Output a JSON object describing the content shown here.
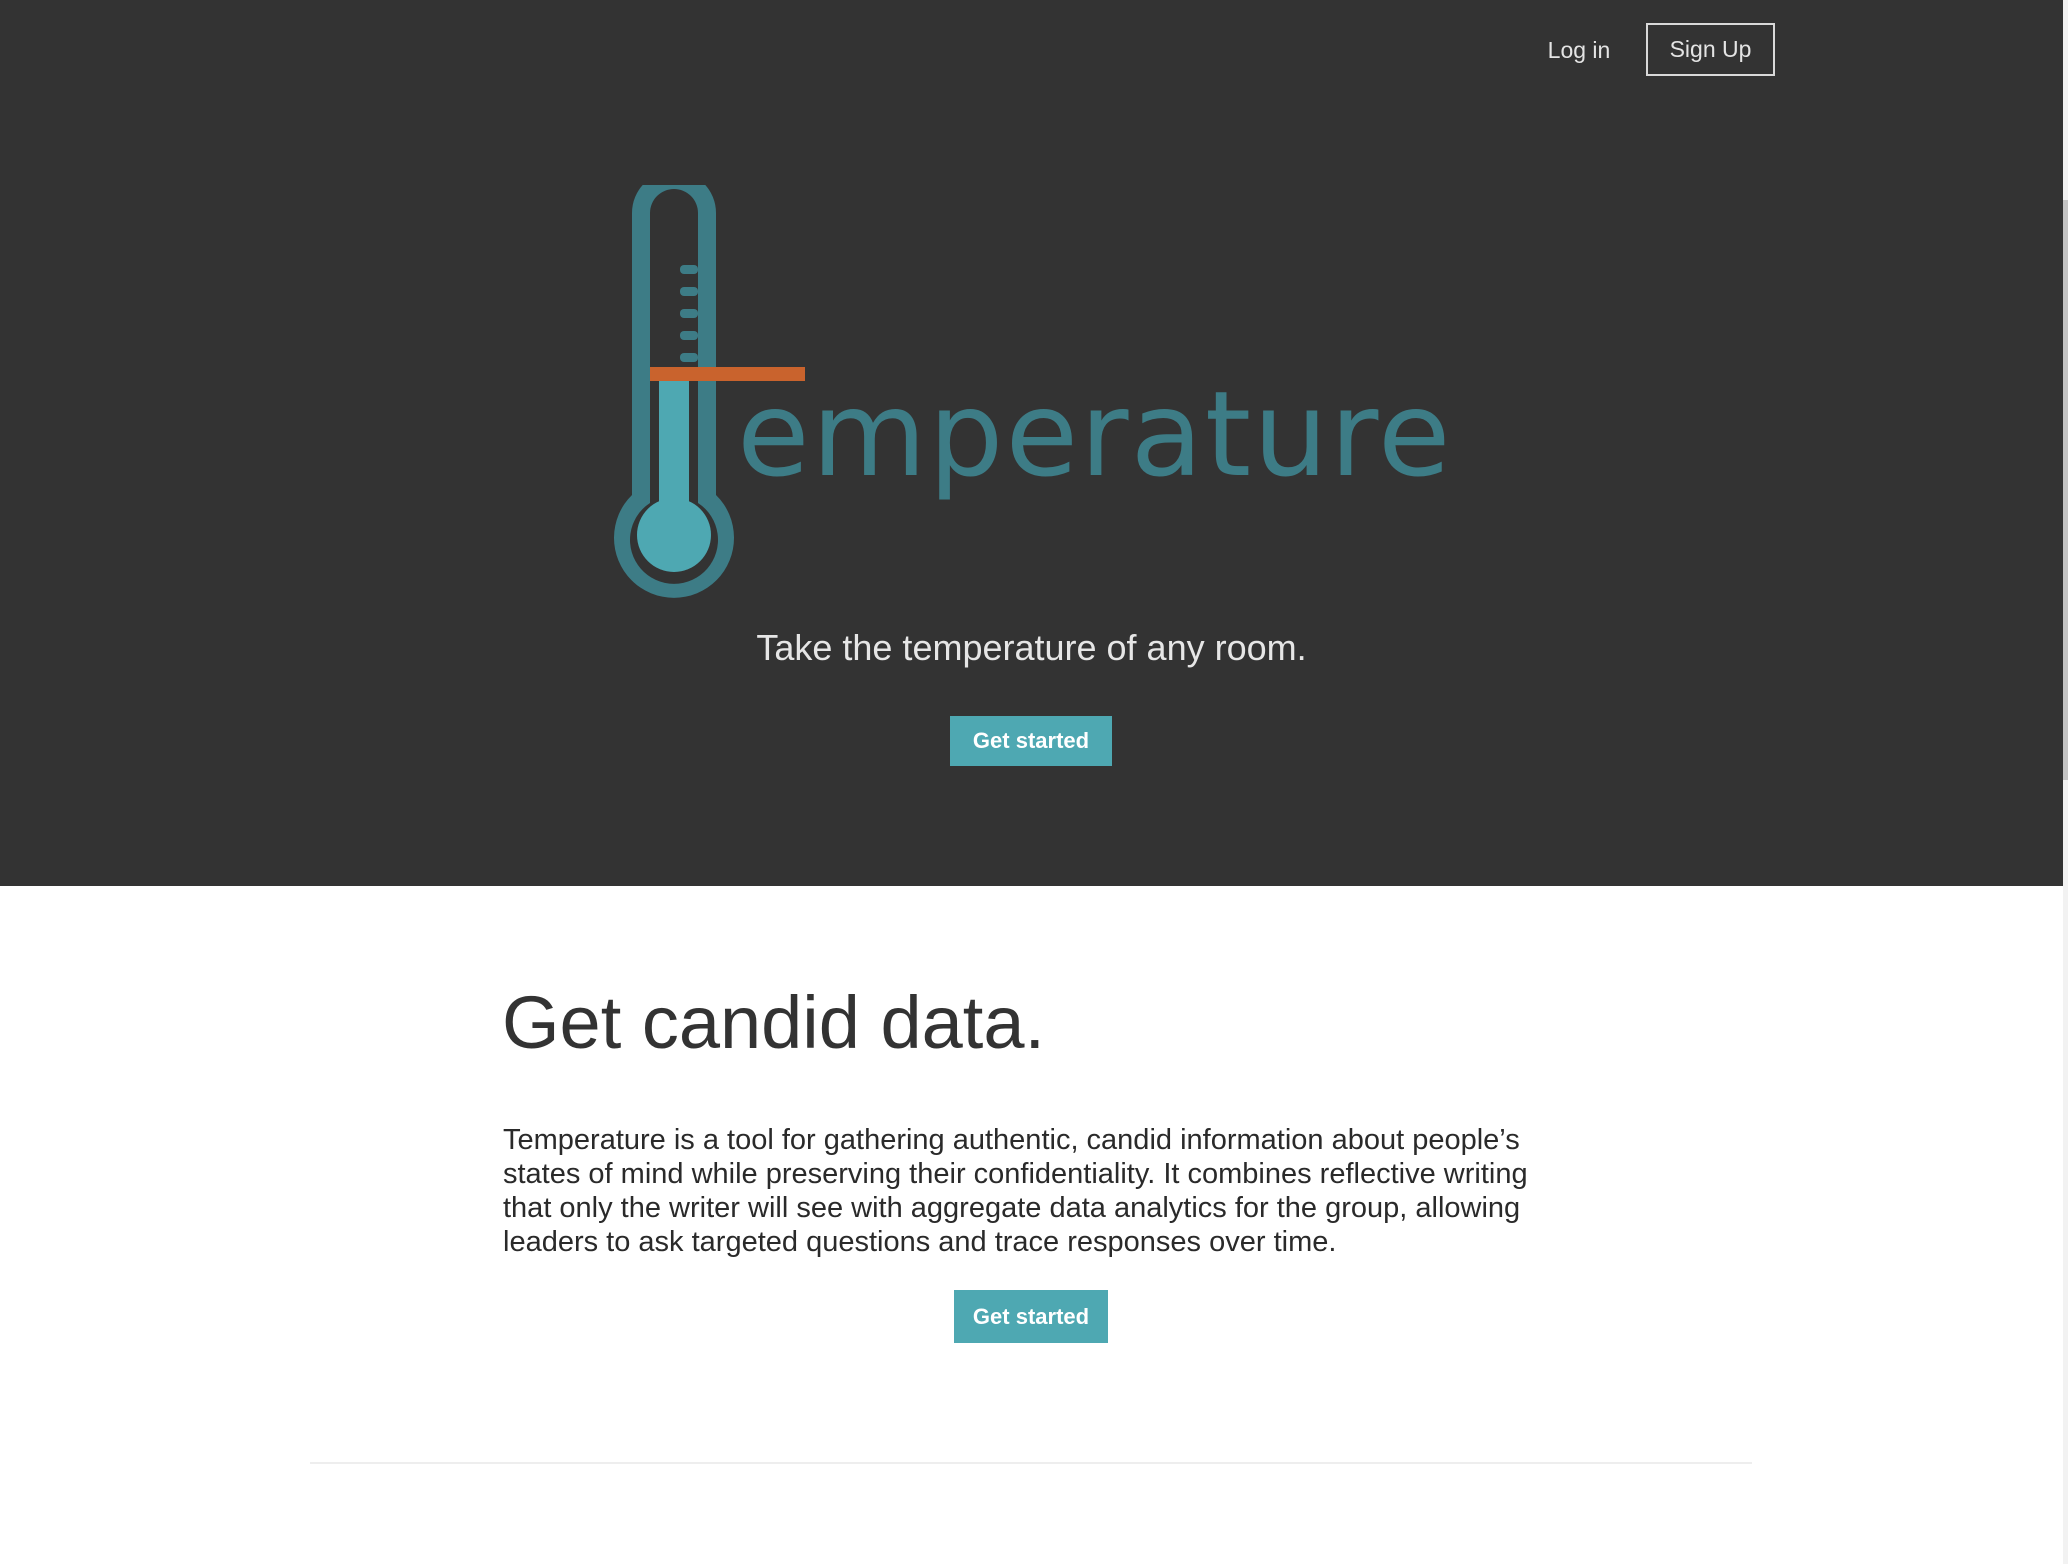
{
  "header": {
    "login_label": "Log in",
    "signup_label": "Sign Up"
  },
  "hero": {
    "logo_text": "emperature",
    "tagline": "Take the temperature of any room.",
    "cta_label": "Get started"
  },
  "content": {
    "title": "Get candid data.",
    "body": "Temperature is a tool for gathering authentic, candid information about people’s states of mind while preserving their confidentiality. It combines reflective writing that only the writer will see with aggregate data analytics for the group, allowing leaders to ask targeted questions and trace responses over time.",
    "cta_label": "Get started"
  },
  "colors": {
    "hero_background": "#333333",
    "brand_teal": "#3d7c86",
    "button_teal": "#4ea8b2",
    "mercury_light": "#4ea8b2",
    "indicator_orange": "#c9632d"
  },
  "icons": {
    "logo": "thermometer-icon"
  }
}
